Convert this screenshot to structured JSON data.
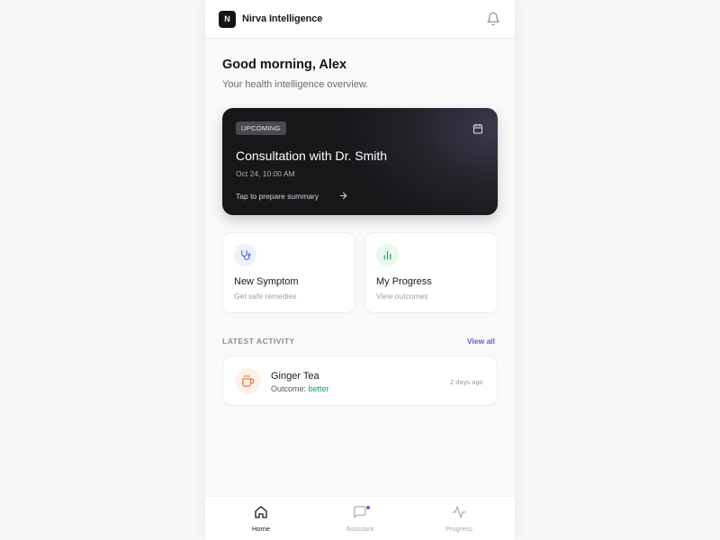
{
  "app": {
    "logo_letter": "N",
    "name": "Nirva Intelligence"
  },
  "greeting": {
    "title": "Good morning, Alex",
    "subtitle": "Your health intelligence overview."
  },
  "appointment": {
    "badge": "UPCOMING",
    "title": "Consultation with Dr. Smith",
    "time": "Oct 24, 10:00 AM",
    "link": "Tap to prepare summary"
  },
  "cards": [
    {
      "title": "New Symptom",
      "subtitle": "Get safe remedies",
      "icon": "stethoscope-icon",
      "color": "#5a5fd8"
    },
    {
      "title": "My Progress",
      "subtitle": "View outcomes",
      "icon": "bar-chart-icon",
      "color": "#18a35a"
    }
  ],
  "activity": {
    "label": "LATEST ACTIVITY",
    "view_all": "View all",
    "items": [
      {
        "title": "Ginger Tea",
        "outcome_label": "Outcome:",
        "outcome_value": "better",
        "time": "2 days ago",
        "icon": "cup-icon"
      }
    ]
  },
  "tabs": [
    {
      "label": "Home",
      "icon": "home-icon",
      "active": true
    },
    {
      "label": "Assistant",
      "icon": "chat-icon",
      "active": false
    },
    {
      "label": "Progress",
      "icon": "pulse-icon",
      "active": false
    }
  ],
  "colors": {
    "accent": "#5a5fd8",
    "success": "#18a35a",
    "warm": "#e07a3f",
    "dark_card": "#17171a"
  }
}
